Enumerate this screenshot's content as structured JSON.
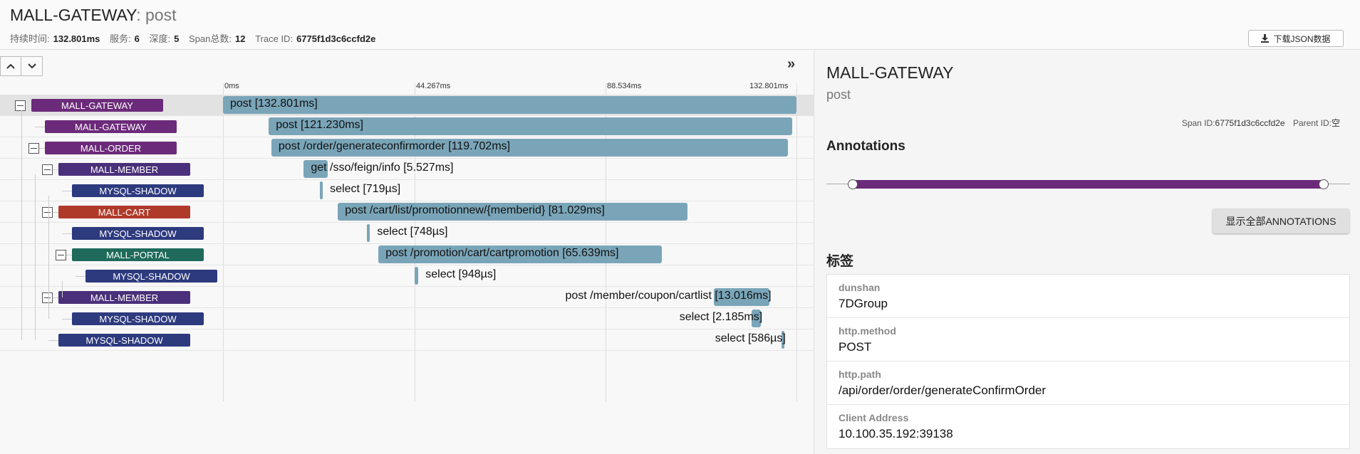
{
  "header": {
    "service": "MALL-GATEWAY",
    "separator": ":",
    "operation": "post",
    "meta": [
      {
        "key": "持续时间:",
        "value": "132.801ms"
      },
      {
        "key": "服务:",
        "value": "6"
      },
      {
        "key": "深度:",
        "value": "5"
      },
      {
        "key": "Span总数:",
        "value": "12"
      },
      {
        "key": "Trace ID:",
        "value": "6775f1d3c6ccfd2e"
      }
    ],
    "download_label": "下载JSON数据"
  },
  "timeline": {
    "expand_all_glyph": "»",
    "ticks": [
      "0ms",
      "44.267ms",
      "88.534ms",
      "132.801ms"
    ],
    "rows": [
      {
        "service": "MALL-GATEWAY",
        "color": "#6c2a7a",
        "text": "post [132.801ms]",
        "start_ms": 0.0,
        "duration_ms": 132.801
      },
      {
        "service": "MALL-GATEWAY",
        "color": "#6c2a7a",
        "text": "post [121.230ms]",
        "start_ms": 10.6,
        "duration_ms": 121.23
      },
      {
        "service": "MALL-ORDER",
        "color": "#6c2a7a",
        "text": "post /order/generateconfirmorder [119.702ms]",
        "start_ms": 11.2,
        "duration_ms": 119.702
      },
      {
        "service": "MALL-MEMBER",
        "color": "#4a2f7a",
        "text": "get /sso/feign/info [5.527ms]",
        "start_ms": 18.7,
        "duration_ms": 5.527
      },
      {
        "service": "MYSQL-SHADOW",
        "color": "#2d3a7e",
        "text": "select [719µs]",
        "start_ms": 22.4,
        "duration_ms": 0.719
      },
      {
        "service": "MALL-CART",
        "color": "#b03a2a",
        "text": "post /cart/list/promotionnew/{memberid} [81.029ms]",
        "start_ms": 26.6,
        "duration_ms": 81.029
      },
      {
        "service": "MYSQL-SHADOW",
        "color": "#2d3a7e",
        "text": "select [748µs]",
        "start_ms": 33.3,
        "duration_ms": 0.748
      },
      {
        "service": "MALL-PORTAL",
        "color": "#1f6a5a",
        "text": "post /promotion/cart/cartpromotion [65.639ms]",
        "start_ms": 36.0,
        "duration_ms": 65.639
      },
      {
        "service": "MYSQL-SHADOW",
        "color": "#2d3a7e",
        "text": "select [948µs]",
        "start_ms": 44.3,
        "duration_ms": 0.948
      },
      {
        "service": "MALL-MEMBER",
        "color": "#4a2f7a",
        "text": "post /member/coupon/cartlist [13.016ms]",
        "start_ms": 113.6,
        "duration_ms": 13.016
      },
      {
        "service": "MYSQL-SHADOW",
        "color": "#2d3a7e",
        "text": "select [2.185ms]",
        "start_ms": 122.4,
        "duration_ms": 2.185
      },
      {
        "service": "MYSQL-SHADOW",
        "color": "#2d3a7e",
        "text": "select [586µs]",
        "start_ms": 129.3,
        "duration_ms": 0.586
      }
    ]
  },
  "detail": {
    "service": "MALL-GATEWAY",
    "operation": "post",
    "span_id_label": "Span ID:",
    "span_id": "6775f1d3c6ccfd2e",
    "parent_id_label": "Parent ID:",
    "parent_id": "空",
    "annotations_title": "Annotations",
    "show_all_label": "显示全部ANNOTATIONS",
    "tags_title": "标签",
    "tags": [
      {
        "key": "dunshan",
        "value": "7DGroup"
      },
      {
        "key": "http.method",
        "value": "POST"
      },
      {
        "key": "http.path",
        "value": "/api/order/order/generateConfirmOrder"
      },
      {
        "key": "Client Address",
        "value": "10.100.35.192:39138"
      }
    ]
  }
}
